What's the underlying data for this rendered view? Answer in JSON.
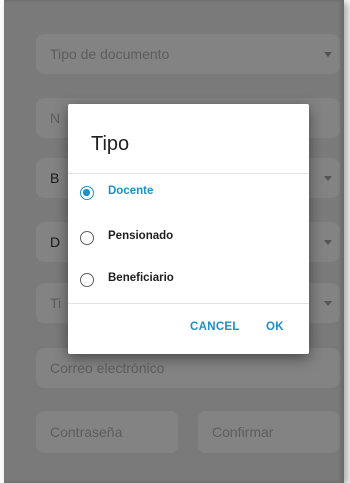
{
  "form": {
    "tipo_documento": "Tipo de documento",
    "row2_prefix": "N",
    "row3_prefix": "B",
    "row4_prefix": "D",
    "row5_prefix": "Ti",
    "correo": "Correo electrónico",
    "contrasena": "Contraseña",
    "confirmar": "Confirmar"
  },
  "dialog": {
    "title": "Tipo",
    "options": [
      {
        "label": "Docente",
        "selected": true
      },
      {
        "label": "Pensionado",
        "selected": false
      },
      {
        "label": "Beneficiario",
        "selected": false
      }
    ],
    "cancel_label": "CANCEL",
    "ok_label": "OK"
  },
  "colors": {
    "accent": "#1e8fc9",
    "backdrop": "#7a7a7a",
    "field": "#838383"
  }
}
